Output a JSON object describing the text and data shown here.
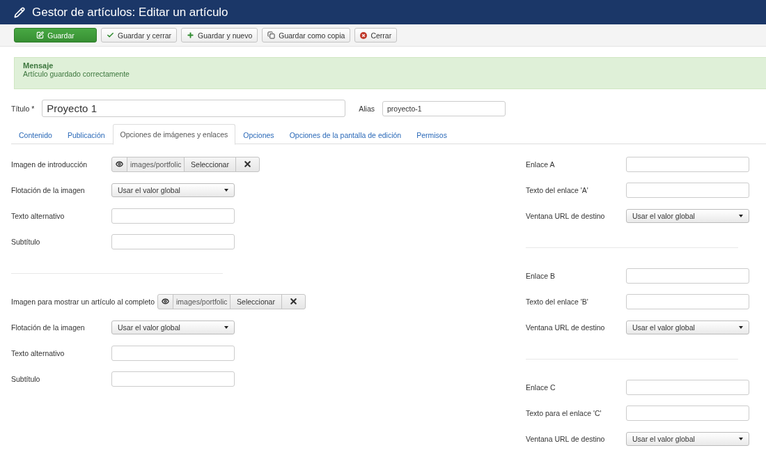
{
  "header": {
    "title": "Gestor de artículos: Editar un artículo"
  },
  "toolbar": [
    {
      "label": "Guardar",
      "kind": "primary"
    },
    {
      "label": "Guardar y cerrar",
      "kind": "default"
    },
    {
      "label": "Guardar y nuevo",
      "kind": "default"
    },
    {
      "label": "Guardar como copia",
      "kind": "default"
    },
    {
      "label": "Cerrar",
      "kind": "default"
    }
  ],
  "message": {
    "heading": "Mensaje",
    "text": "Artículo guardado correctamente"
  },
  "title_field": {
    "label": "Título *",
    "value": "Proyecto 1"
  },
  "alias_field": {
    "label": "Alias",
    "value": "proyecto-1"
  },
  "tabs": [
    {
      "label": "Contenido",
      "selected": false
    },
    {
      "label": "Publicación",
      "selected": false
    },
    {
      "label": "Opciones de imágenes y enlaces",
      "selected": true
    },
    {
      "label": "Opciones",
      "selected": false
    },
    {
      "label": "Opciones de la pantalla de edición",
      "selected": false
    },
    {
      "label": "Permisos",
      "selected": false
    }
  ],
  "left_groups": [
    [
      {
        "kind": "media",
        "label": "Imagen de introducción",
        "value": "images/portfolic",
        "button": "Seleccionar"
      },
      {
        "kind": "select",
        "label": "Flotación de la imagen",
        "value": "Usar el valor global"
      },
      {
        "kind": "text",
        "label": "Texto alternativo"
      },
      {
        "kind": "text",
        "label": "Subtítulo"
      }
    ],
    [
      {
        "kind": "media",
        "label": "Imagen para mostrar un artículo al completo",
        "value": "images/portfolic",
        "button": "Seleccionar"
      },
      {
        "kind": "select",
        "label": "Flotación de la imagen",
        "value": "Usar el valor global"
      },
      {
        "kind": "text",
        "label": "Texto alternativo"
      },
      {
        "kind": "text",
        "label": "Subtítulo"
      }
    ]
  ],
  "right_groups": [
    [
      {
        "kind": "text",
        "label": "Enlace A"
      },
      {
        "kind": "text",
        "label": "Texto del enlace 'A'"
      },
      {
        "kind": "select",
        "label": "Ventana URL de destino",
        "value": "Usar el valor global"
      }
    ],
    [
      {
        "kind": "text",
        "label": "Enlace B"
      },
      {
        "kind": "text",
        "label": "Texto del enlace 'B'"
      },
      {
        "kind": "select",
        "label": "Ventana URL de destino",
        "value": "Usar el valor global"
      }
    ],
    [
      {
        "kind": "text",
        "label": "Enlace C"
      },
      {
        "kind": "text",
        "label": "Texto para el enlace 'C'"
      },
      {
        "kind": "select",
        "label": "Ventana URL de destino",
        "value": "Usar el valor global"
      }
    ]
  ]
}
